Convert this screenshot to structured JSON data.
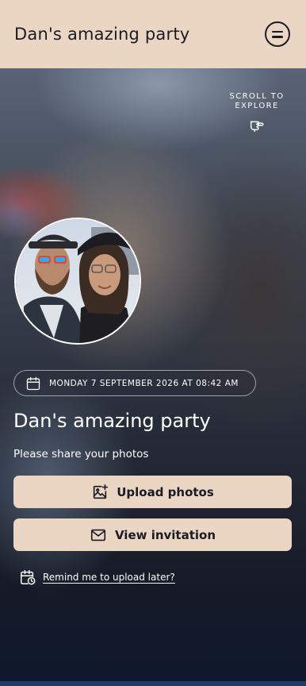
{
  "header": {
    "title": "Dan's amazing party",
    "menu_icon": "menu-circle-icon"
  },
  "hero": {
    "scroll_hint": "SCROLL TO EXPLORE",
    "scroll_icon": "pointing-hand-icon",
    "avatar_icon": "profile-photo",
    "date_icon": "calendar-icon",
    "date_text": "MONDAY 7 SEPTEMBER 2026 AT 08:42 AM",
    "event_title": "Dan's amazing party",
    "subtitle": "Please share your photos"
  },
  "actions": {
    "upload_label": "Upload photos",
    "upload_icon": "image-plus-icon",
    "invite_label": "View invitation",
    "invite_icon": "envelope-icon"
  },
  "remind": {
    "label": "Remind me to upload later?",
    "icon": "calendar-clock-icon"
  },
  "colors": {
    "accent": "#ead6c3",
    "text_dark": "#1b1b24"
  }
}
